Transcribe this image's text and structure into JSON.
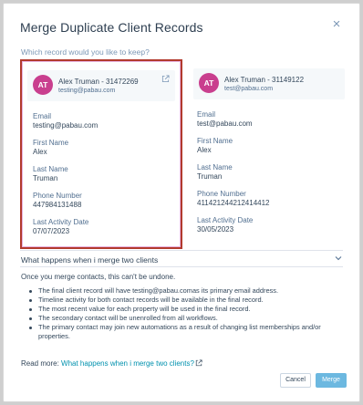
{
  "modal": {
    "title": "Merge Duplicate Client Records",
    "close_glyph": "×",
    "question": "Which record would you like to keep?"
  },
  "records": [
    {
      "initials": "AT",
      "name": "Alex Truman - 31472269",
      "email_sub": "testing@pabau.com",
      "fields": [
        {
          "label": "Email",
          "value": "testing@pabau.com"
        },
        {
          "label": "First Name",
          "value": "Alex"
        },
        {
          "label": "Last Name",
          "value": "Truman"
        },
        {
          "label": "Phone Number",
          "value": "447984131488"
        },
        {
          "label": "Last Activity Date",
          "value": "07/07/2023"
        }
      ],
      "selected": true
    },
    {
      "initials": "AT",
      "name": "Alex Truman - 31149122",
      "email_sub": "test@pabau.com",
      "fields": [
        {
          "label": "Email",
          "value": "test@pabau.com"
        },
        {
          "label": "First Name",
          "value": "Alex"
        },
        {
          "label": "Last Name",
          "value": "Truman"
        },
        {
          "label": "Phone Number",
          "value": "41142124421241441​2"
        },
        {
          "label": "Last Activity Date",
          "value": "30/05/2023"
        }
      ],
      "selected": false
    }
  ],
  "info": {
    "heading": "What happens when i merge two clients",
    "intro": "Once you merge contacts, this can't be undone.",
    "bullets": [
      "The final client record will have testing@pabau.comas its primary email address.",
      "Timeline activity for both contact records will be available in the final record.",
      "The most recent value for each property will be used in the final record.",
      "The secondary contact will be unenrolled from all workflows.",
      "The primary contact may join new automations as a result of changing list memberships and/or properties."
    ],
    "readmore_prefix": "Read more: ",
    "readmore_link": "What happens when i merge two clients?"
  },
  "footer": {
    "cancel_label": "Cancel",
    "merge_label": "Merge"
  },
  "colors": {
    "avatar": "#c93f8e",
    "selected_border": "#b23a2e",
    "link": "#0091ae",
    "primary_button": "#6cb8e0"
  },
  "icons": {
    "close": "close-icon",
    "external": "external-link-icon",
    "chevron": "chevron-down-icon"
  }
}
